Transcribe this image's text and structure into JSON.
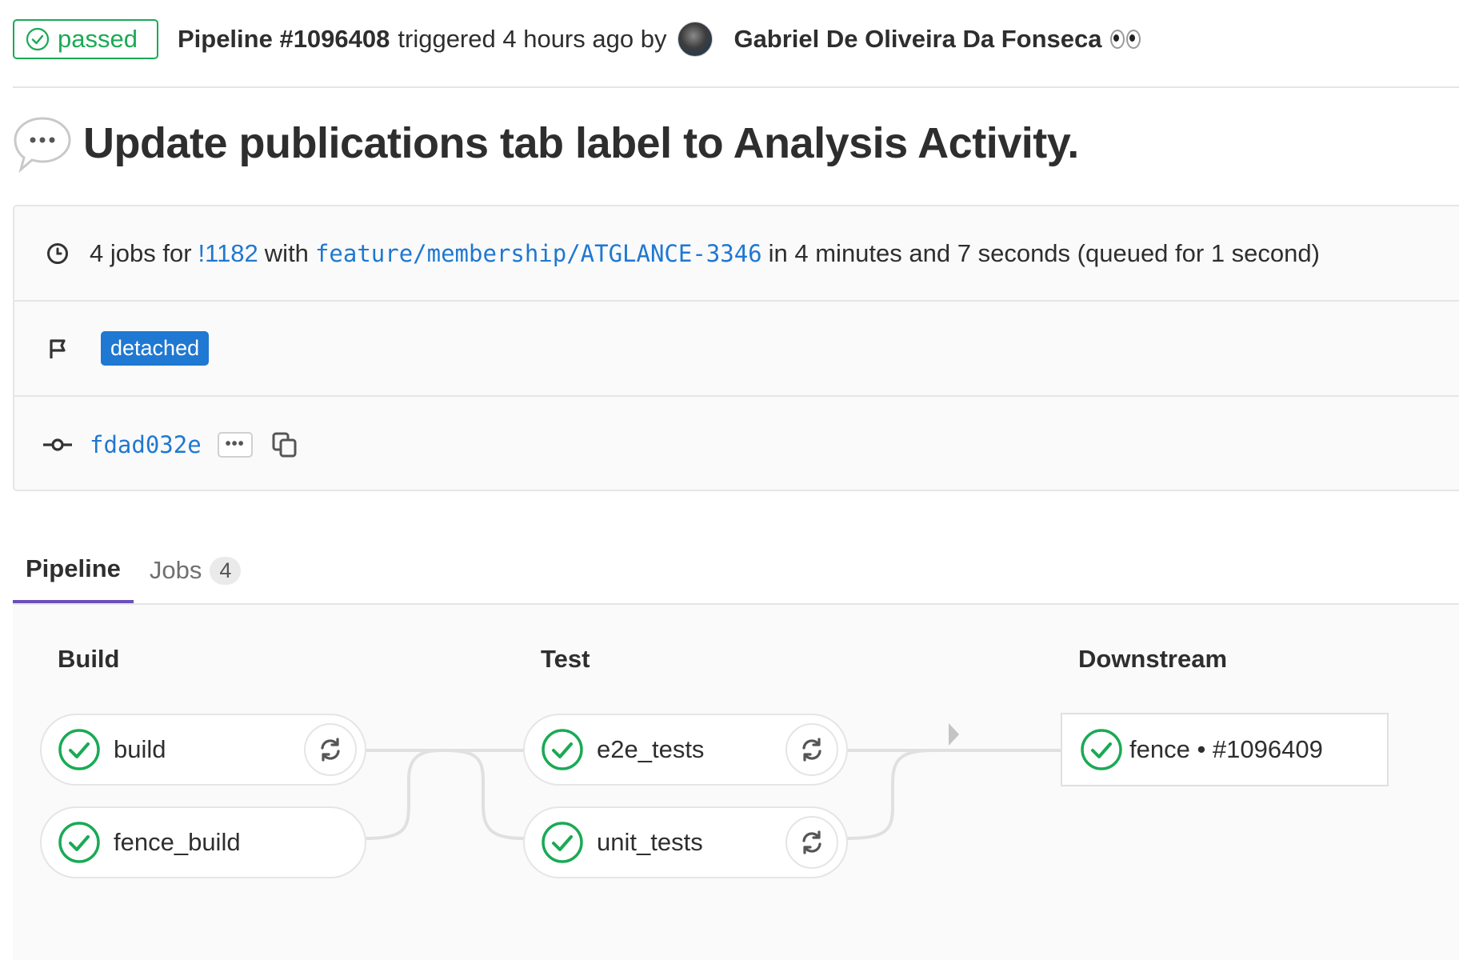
{
  "header": {
    "status": "passed",
    "pipeline_label": "Pipeline #1096408",
    "triggered_text": "triggered 4 hours ago by",
    "user_name": "Gabriel De Oliveira Da Fonseca"
  },
  "title": "Update publications tab label to Analysis Activity.",
  "info": {
    "jobs_prefix": "4 jobs for",
    "mr_link": "!1182",
    "with_text": "with",
    "branch": "feature/membership/ATGLANCE-3346",
    "duration_text": "in 4 minutes and 7 seconds (queued for 1 second)",
    "ref_badge": "detached",
    "commit_sha": "fdad032e",
    "ellipsis": "•••"
  },
  "tabs": [
    {
      "label": "Pipeline",
      "active": true
    },
    {
      "label": "Jobs",
      "count": "4",
      "active": false
    }
  ],
  "stages": [
    {
      "name": "Build",
      "jobs": [
        "build",
        "fence_build"
      ]
    },
    {
      "name": "Test",
      "jobs": [
        "e2e_tests",
        "unit_tests"
      ]
    },
    {
      "name": "Downstream",
      "jobs": [
        "fence • #1096409"
      ]
    }
  ],
  "colors": {
    "success": "#1aaa55",
    "link": "#1f78d1",
    "tab_active": "#6b4fbb"
  },
  "icons": [
    "check-circle-icon",
    "clock-icon",
    "flag-icon",
    "commit-icon",
    "copy-icon",
    "retry-icon",
    "speech-bubble-icon",
    "eyes-icon"
  ]
}
